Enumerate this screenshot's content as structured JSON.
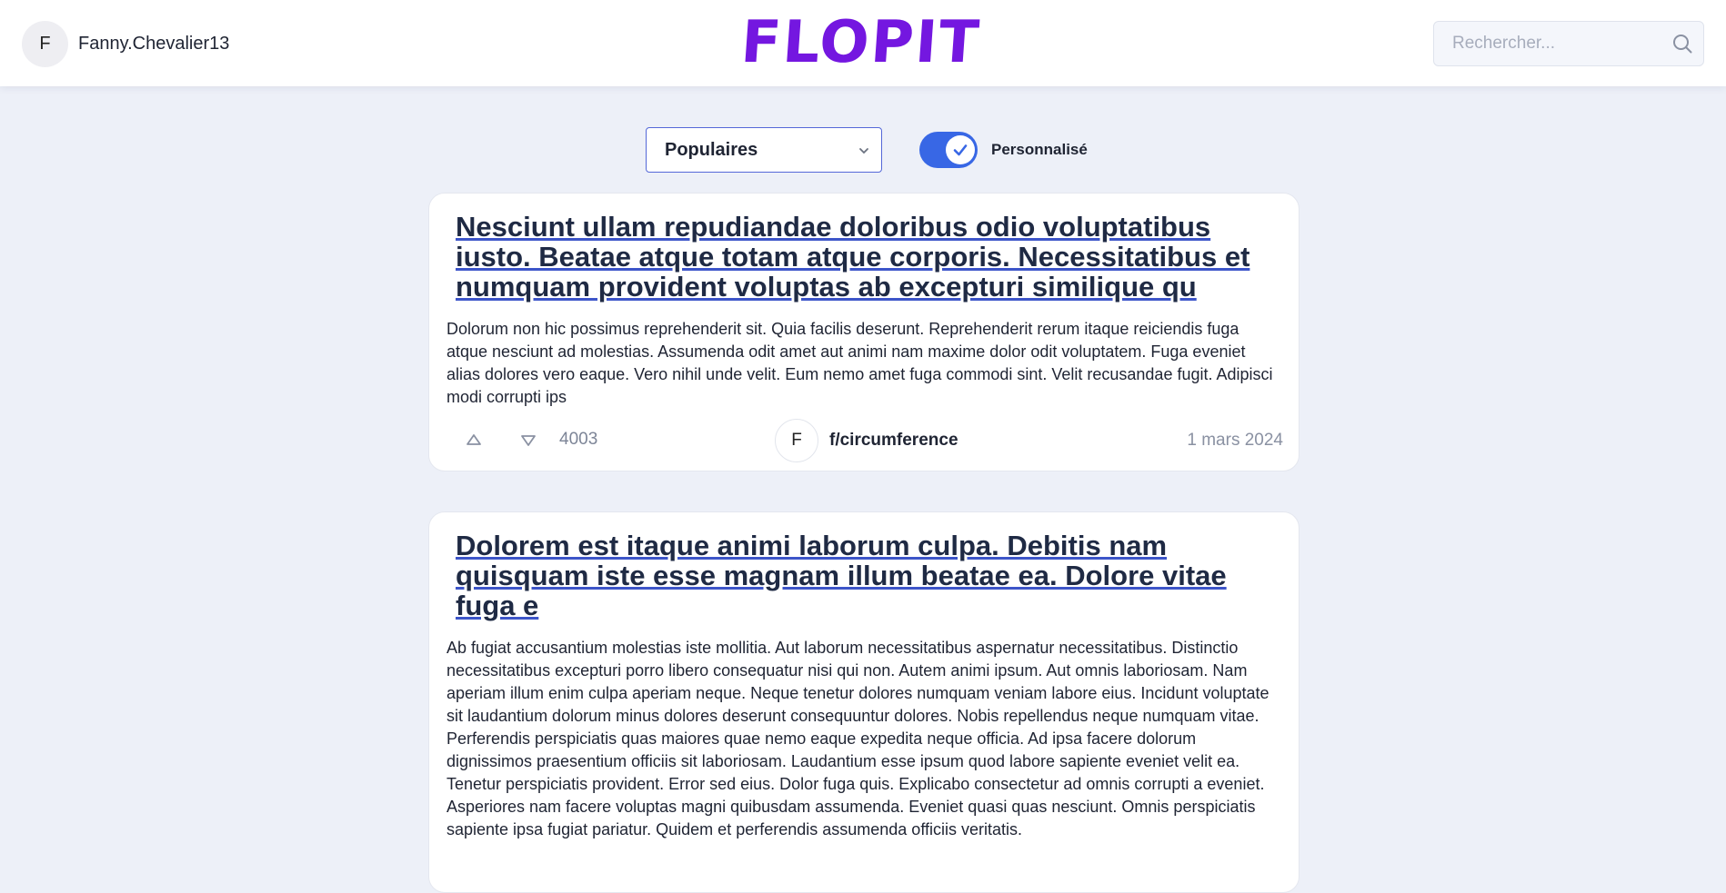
{
  "header": {
    "user": {
      "avatar_initial": "F",
      "username": "Fanny.Chevalier13"
    },
    "logo_text": "FLOPIT",
    "search": {
      "placeholder": "Rechercher...",
      "value": ""
    }
  },
  "controls": {
    "sort": {
      "selected": "Populaires"
    },
    "personalized_toggle": {
      "label": "Personnalisé",
      "on": true
    }
  },
  "posts": [
    {
      "title": "Nesciunt ullam repudiandae doloribus odio voluptatibus iusto. Beatae atque totam atque corporis. Necessitatibus et numquam provident voluptas ab excepturi similique qu",
      "body": "Dolorum non hic possimus reprehenderit sit. Quia facilis deserunt. Reprehenderit rerum itaque reiciendis fuga atque nesciunt ad molestias. Assumenda odit amet aut animi nam maxime dolor odit voluptatem. Fuga eveniet alias dolores vero eaque. Vero nihil unde velit. Eum nemo amet fuga commodi sint. Velit recusandae fugit. Adipisci modi corrupti ips",
      "score": "4003",
      "community_initial": "F",
      "community": "f/circumference",
      "date": "1 mars 2024"
    },
    {
      "title": "Dolorem est itaque animi laborum culpa. Debitis nam quisquam iste esse magnam illum beatae ea. Dolore vitae fuga e",
      "body": "Ab fugiat accusantium molestias iste mollitia. Aut laborum necessitatibus aspernatur necessitatibus. Distinctio necessitatibus excepturi porro libero consequatur nisi qui non. Autem animi ipsum. Aut omnis laboriosam. Nam aperiam illum enim culpa aperiam neque. Neque tenetur dolores numquam veniam labore eius. Incidunt voluptate sit laudantium dolorum minus dolores deserunt consequuntur dolores. Nobis repellendus neque numquam vitae. Perferendis perspiciatis quas maiores quae nemo eaque expedita neque officia. Ad ipsa facere dolorum dignissimos praesentium officiis sit laboriosam. Laudantium esse ipsum quod labore sapiente eveniet velit ea. Tenetur perspiciatis provident. Error sed eius. Dolor fuga quis. Explicabo consectetur ad omnis corrupti a eveniet. Asperiores nam facere voluptas magni quibusdam assumenda. Eveniet quasi quas nesciunt. Omnis perspiciatis sapiente ipsa fugiat pariatur. Quidem et perferendis assumenda officiis veritatis."
    }
  ],
  "colors": {
    "brand": "#7417e0",
    "accent": "#3867e5",
    "background": "#edf0f8"
  }
}
